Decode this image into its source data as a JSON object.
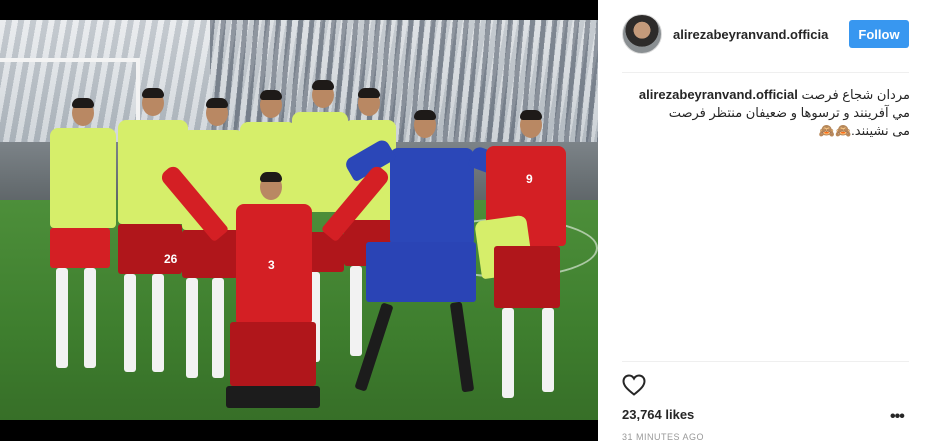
{
  "post": {
    "username": "alirezabeyranvand.officia",
    "follow_label": "Follow",
    "caption_user": "alirezabeyranvand.official",
    "caption_line1": "مردان شجاع فرصت",
    "caption_line2": "مي آفرينند و ترسوها و ضعيفان منتظر فرصت",
    "caption_line3": "مى نشينند.",
    "caption_emoji": "🙈🙈",
    "likes": "23,764 likes",
    "time": "31 MINUTES AGO",
    "more_label": "•••"
  },
  "photo": {
    "numbers": [
      "3",
      "26",
      "9"
    ]
  },
  "colors": {
    "follow_bg": "#3897f0",
    "bib": "#d6ee6a",
    "kit_red": "#d41f24",
    "keeper_blue": "#2b47b8"
  },
  "icons": {
    "like": "heart-icon",
    "options": "more-options-icon"
  }
}
